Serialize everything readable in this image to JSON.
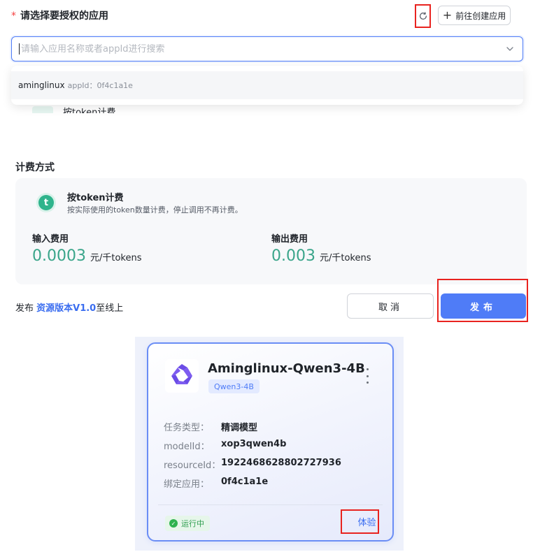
{
  "app_select": {
    "required_mark": "*",
    "label": "请选择要授权的应用",
    "create_button": "前往创建应用",
    "search_placeholder": "请输入应用名称或者appId进行搜索",
    "options": [
      {
        "name": "aminglinux",
        "id_label": "appId：0f4c1a1e"
      }
    ],
    "peek_text": "按token计费"
  },
  "billing": {
    "title": "计费方式",
    "method_title": "按token计费",
    "method_desc": "按实际使用的token数量计费，停止调用不再计费。",
    "icon_letter": "t",
    "input_label": "输入费用",
    "input_value": "0.0003",
    "input_unit": "元/千tokens",
    "output_label": "输出费用",
    "output_value": "0.003",
    "output_unit": "元/千tokens"
  },
  "publish": {
    "prefix": "发布 ",
    "version_link": "资源版本V1.0",
    "suffix": "至线上",
    "cancel_label": "取消",
    "publish_label": "发布"
  },
  "model_card": {
    "name": "Aminglinux-Qwen3-4B",
    "tag": "Qwen3-4B",
    "rows": [
      {
        "key": "任务类型：",
        "value": "精调模型"
      },
      {
        "key": "modelId：",
        "value": "xop3qwen4b"
      },
      {
        "key": "resourceId：",
        "value": "1922468628802727936"
      },
      {
        "key": "绑定应用：",
        "value": "0f4c1a1e"
      }
    ],
    "status": "运行中",
    "try_label": "体验"
  },
  "colors": {
    "primary": "#4f7cf7",
    "accent_green": "#3aa58a",
    "highlight_red": "#e8231f",
    "status_green": "#2e9e4f"
  }
}
